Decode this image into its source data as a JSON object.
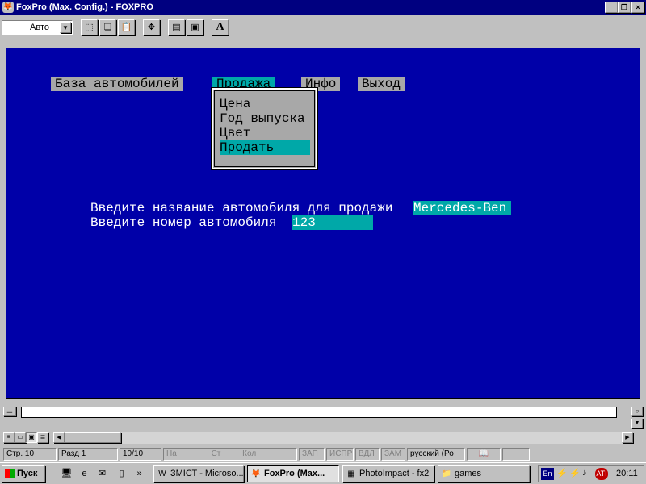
{
  "window": {
    "title": "FoxPro  (Max. Config.) - FOXPRO",
    "min_label": "_",
    "max_label": "❐",
    "close_label": "×"
  },
  "toolbar": {
    "combo_value": "Авто",
    "font_button_label": "A"
  },
  "menu": {
    "items": [
      {
        "label": "База автомобилей"
      },
      {
        "label": "Продажа"
      },
      {
        "label": "Инфо"
      },
      {
        "label": "Выход"
      }
    ],
    "popup": [
      {
        "label": "Цена"
      },
      {
        "label": "Год выпуска"
      },
      {
        "label": "Цвет"
      },
      {
        "label": "Продать"
      }
    ]
  },
  "form": {
    "prompt1": "Введите название автомобиля для продажи",
    "value1": "Mercedes-Ben",
    "prompt2": "Введите номер автомобиля",
    "value2": "123"
  },
  "statusbar": {
    "line": "Стр. 10",
    "section": "Разд 1",
    "page": "10/10",
    "at": "На",
    "st": "Ст",
    "col": "Кол",
    "zap": "ЗАП",
    "ispr": "ИСПР",
    "vdl": "ВДЛ",
    "zam": "ЗАМ",
    "lang": "русский (Ро"
  },
  "taskbar": {
    "start_label": "Пуск",
    "tasks": [
      {
        "label": "ЗМІСТ - Microso..."
      },
      {
        "label": "FoxPro  (Max..."
      },
      {
        "label": "PhotoImpact - fx2"
      },
      {
        "label": "games"
      }
    ],
    "tray_lang": "En",
    "clock": "20:11"
  }
}
